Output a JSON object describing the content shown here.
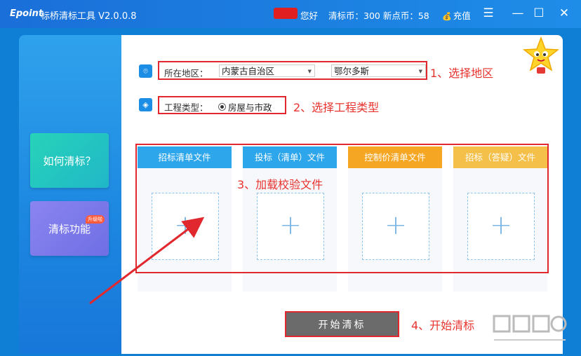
{
  "titlebar": {
    "logo": "Epoint",
    "title": "标桥清标工具 V2.0.0.8",
    "hello": "您好",
    "coins": "清标币：300  新点币：58",
    "recharge": "充值",
    "menu_icon": "☰",
    "min_icon": "—",
    "max_icon": "☐",
    "close_icon": "✕"
  },
  "nav": {
    "how_to": "如何清标？",
    "features": "清标功能",
    "features_badge": "升级啦"
  },
  "form": {
    "region_label": "所在地区：",
    "province": "内蒙古自治区",
    "city": "鄂尔多斯",
    "type_label": "工程类型：",
    "type_option": "房屋与市政"
  },
  "upload": {
    "cards": [
      {
        "label": "招标清单文件",
        "color": "#2ea6ec"
      },
      {
        "label": "投标（清单）文件",
        "color": "#2ea6ec"
      },
      {
        "label": "控制价清单文件",
        "color": "#f5a623"
      },
      {
        "label": "招标（答疑）文件",
        "color": "#f5c04a"
      }
    ]
  },
  "start_button": "开始清标",
  "annotations": {
    "a1": "1、选择地区",
    "a2": "2、选择工程类型",
    "a3": "3、加载校验文件",
    "a4": "4、开始清标"
  },
  "colors": {
    "accent": "#1c8ee6",
    "annotation": "#e8332e"
  }
}
